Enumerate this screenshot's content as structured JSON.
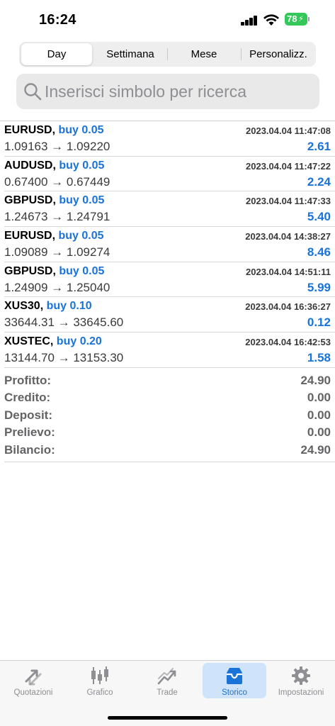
{
  "status": {
    "time": "16:24",
    "battery": "78"
  },
  "segments": [
    "Day",
    "Settimana",
    "Mese",
    "Personalizz."
  ],
  "search": {
    "placeholder": "Inserisci simbolo per ricerca"
  },
  "deals": [
    {
      "symbol": "EURUSD,",
      "side": "buy 0.05",
      "datetime": "2023.04.04 11:47:08",
      "prices": "1.09163 → 1.09220",
      "profit": "2.61"
    },
    {
      "symbol": "AUDUSD,",
      "side": "buy 0.05",
      "datetime": "2023.04.04 11:47:22",
      "prices": "0.67400 → 0.67449",
      "profit": "2.24"
    },
    {
      "symbol": "GBPUSD,",
      "side": "buy 0.05",
      "datetime": "2023.04.04 11:47:33",
      "prices": "1.24673 → 1.24791",
      "profit": "5.40"
    },
    {
      "symbol": "EURUSD,",
      "side": "buy 0.05",
      "datetime": "2023.04.04 14:38:27",
      "prices": "1.09089 → 1.09274",
      "profit": "8.46"
    },
    {
      "symbol": "GBPUSD,",
      "side": "buy 0.05",
      "datetime": "2023.04.04 14:51:11",
      "prices": "1.24909 → 1.25040",
      "profit": "5.99"
    },
    {
      "symbol": "XUS30,",
      "side": "buy 0.10",
      "datetime": "2023.04.04 16:36:27",
      "prices": "33644.31 → 33645.60",
      "profit": "0.12"
    },
    {
      "symbol": "XUSTEC,",
      "side": "buy 0.20",
      "datetime": "2023.04.04 16:42:53",
      "prices": "13144.70 → 13153.30",
      "profit": "1.58"
    }
  ],
  "summary": [
    {
      "label": "Profitto:",
      "value": "24.90"
    },
    {
      "label": "Credito:",
      "value": "0.00"
    },
    {
      "label": "Deposit:",
      "value": "0.00"
    },
    {
      "label": "Prelievo:",
      "value": "0.00"
    },
    {
      "label": "Bilancio:",
      "value": "24.90"
    }
  ],
  "tabs": [
    {
      "label": "Quotazioni",
      "icon": "quotes-arrows-icon"
    },
    {
      "label": "Grafico",
      "icon": "candlestick-chart-icon"
    },
    {
      "label": "Trade",
      "icon": "trade-trend-icon"
    },
    {
      "label": "Storico",
      "icon": "history-inbox-icon"
    },
    {
      "label": "Impostazioni",
      "icon": "gear-icon"
    }
  ],
  "colors": {
    "accent": "#1a73d9",
    "active_tab_bg": "#cfe3fb",
    "battery": "#34c759"
  }
}
